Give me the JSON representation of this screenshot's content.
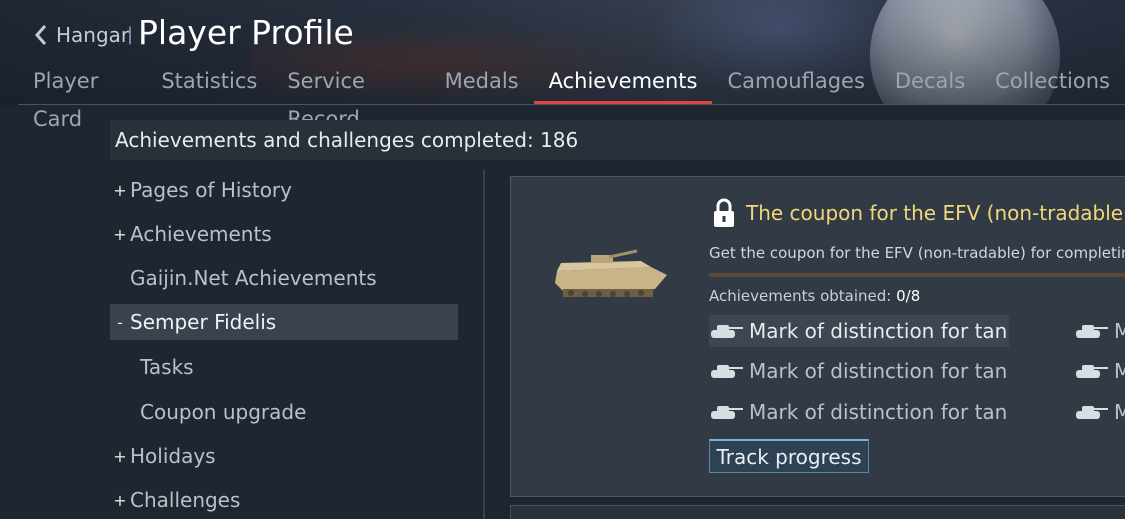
{
  "header": {
    "back_label": "Hangar",
    "separator": "|",
    "title": "Player Profile"
  },
  "tabs": [
    {
      "label": "Player Card",
      "active": false
    },
    {
      "label": "Statistics",
      "active": false
    },
    {
      "label": "Service Record",
      "active": false
    },
    {
      "label": "Medals",
      "active": false
    },
    {
      "label": "Achievements",
      "active": true
    },
    {
      "label": "Camouflages",
      "active": false
    },
    {
      "label": "Decals",
      "active": false
    },
    {
      "label": "Collections",
      "active": false
    }
  ],
  "summary": {
    "text": "Achievements and challenges completed: 186"
  },
  "nav": [
    {
      "prefix": "+",
      "label": "Pages of History",
      "selected": false,
      "sub": false
    },
    {
      "prefix": "+",
      "label": "Achievements",
      "selected": false,
      "sub": false
    },
    {
      "prefix": "",
      "label": "Gaijin.Net Achievements",
      "selected": false,
      "sub": false
    },
    {
      "prefix": "-",
      "label": "Semper Fidelis",
      "selected": true,
      "sub": false
    },
    {
      "prefix": "",
      "label": "Tasks",
      "selected": false,
      "sub": true
    },
    {
      "prefix": "",
      "label": "Coupon upgrade",
      "selected": false,
      "sub": true
    },
    {
      "prefix": "+",
      "label": "Holidays",
      "selected": false,
      "sub": false
    },
    {
      "prefix": "+",
      "label": "Challenges",
      "selected": false,
      "sub": false
    }
  ],
  "achievement": {
    "title": "The coupon for the EFV (non-tradable)",
    "description": "Get the coupon for the EFV (non-tradable) for completing",
    "obtained_label": "Achievements obtained:",
    "obtained_value": "0/8",
    "items": [
      "Mark of distinction for tanke",
      "Mark of distinction for tankers",
      "Mark of distinction for tankers",
      "M",
      "M",
      "M"
    ],
    "track_button": "Track progress"
  },
  "colors": {
    "accent_red": "#e0453a",
    "title_gold": "#f0d97a",
    "button_border": "#7db2d8"
  },
  "icons": [
    "chevron-left-icon",
    "lock-icon",
    "tank-icon",
    "efv-vehicle-image"
  ]
}
